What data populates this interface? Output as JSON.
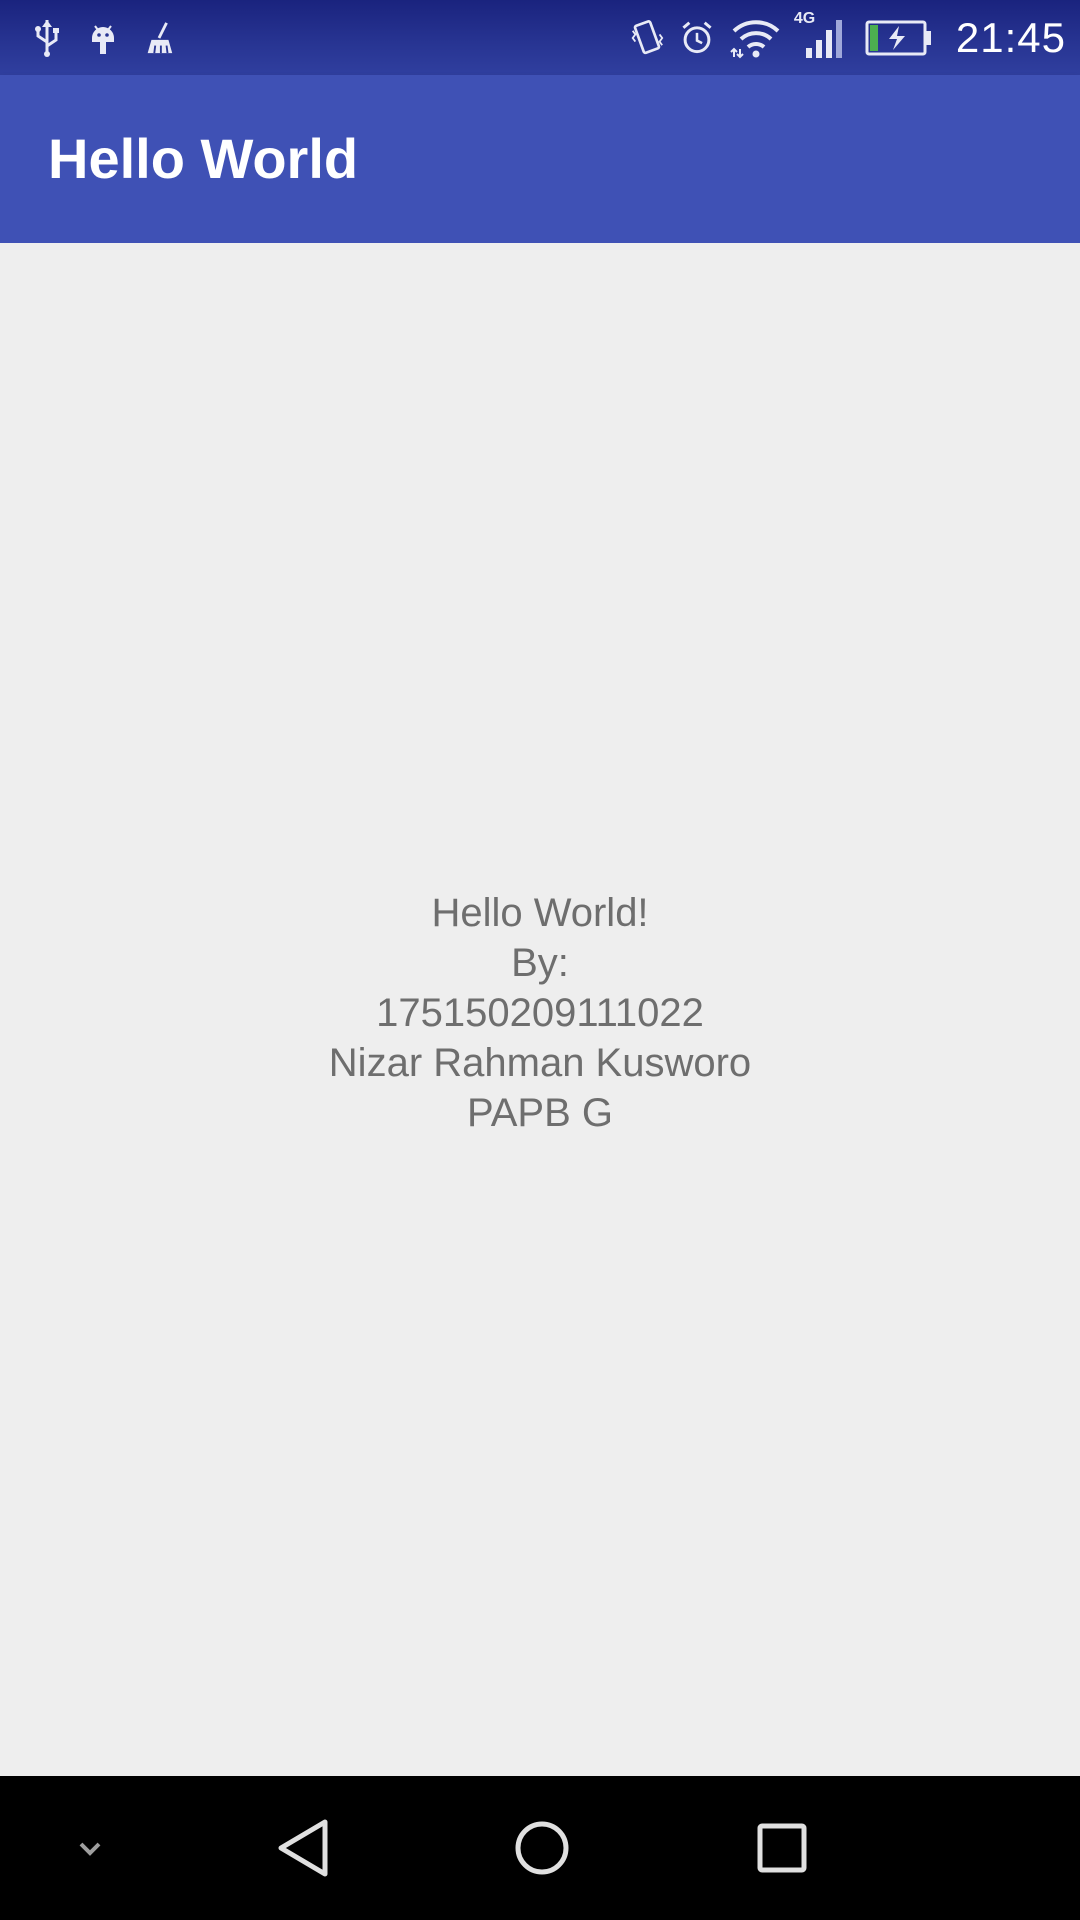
{
  "status_bar": {
    "time": "21:45",
    "network_label": "4G",
    "left_icons": [
      "usb-icon",
      "android-debug-icon",
      "cleaner-icon"
    ],
    "right_icons": [
      "vibrate-icon",
      "alarm-icon",
      "wifi-icon",
      "signal-icon",
      "battery-charging-icon"
    ]
  },
  "app_bar": {
    "title": "Hello World"
  },
  "content": {
    "lines": [
      "Hello World!",
      "By:",
      "175150209111022",
      "Nizar Rahman Kusworo",
      "PAPB G"
    ]
  },
  "nav_bar": {
    "icons": [
      "chevron-down-icon",
      "back-icon",
      "home-icon",
      "recents-icon"
    ]
  },
  "colors": {
    "status_bar": "#283593",
    "app_bar": "#3f51b5",
    "background": "#eeeeee",
    "text": "#6e6e6e",
    "nav_bar": "#000000"
  }
}
